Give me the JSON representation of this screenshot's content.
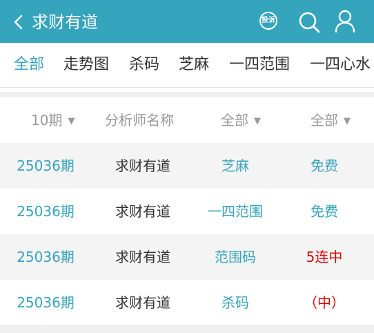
{
  "header": {
    "back_icon": "chevron-left-icon",
    "title": "求财有道",
    "complaint_label": "投诉",
    "search_icon": "search-icon",
    "user_icon": "user-icon",
    "background": "#35a4bd"
  },
  "tabs": [
    {
      "label": "全部",
      "active": true
    },
    {
      "label": "走势图",
      "active": false
    },
    {
      "label": "杀码",
      "active": false
    },
    {
      "label": "芝麻",
      "active": false
    },
    {
      "label": "一四范围",
      "active": false
    },
    {
      "label": "一四心水",
      "active": false
    }
  ],
  "table": {
    "headers": {
      "period": "10期",
      "analyst": "分析师名称",
      "category": "全部",
      "status": "全部",
      "caret": "▼"
    },
    "rows": [
      {
        "period": "25036期",
        "analyst": "求财有道",
        "category": "芝麻",
        "status": "免费",
        "status_color": "#35a4bd"
      },
      {
        "period": "25036期",
        "analyst": "求财有道",
        "category": "一四范围",
        "status": "免费",
        "status_color": "#35a4bd"
      },
      {
        "period": "25036期",
        "analyst": "求财有道",
        "category": "范围码",
        "status": "5连中",
        "status_color": "#e00000"
      },
      {
        "period": "25036期",
        "analyst": "求财有道",
        "category": "杀码",
        "status": "（中）",
        "status_color": "#e00000"
      }
    ]
  },
  "colors": {
    "accent": "#35a4bd",
    "hit": "#e00000",
    "row_alt": "#f4f4f4"
  }
}
